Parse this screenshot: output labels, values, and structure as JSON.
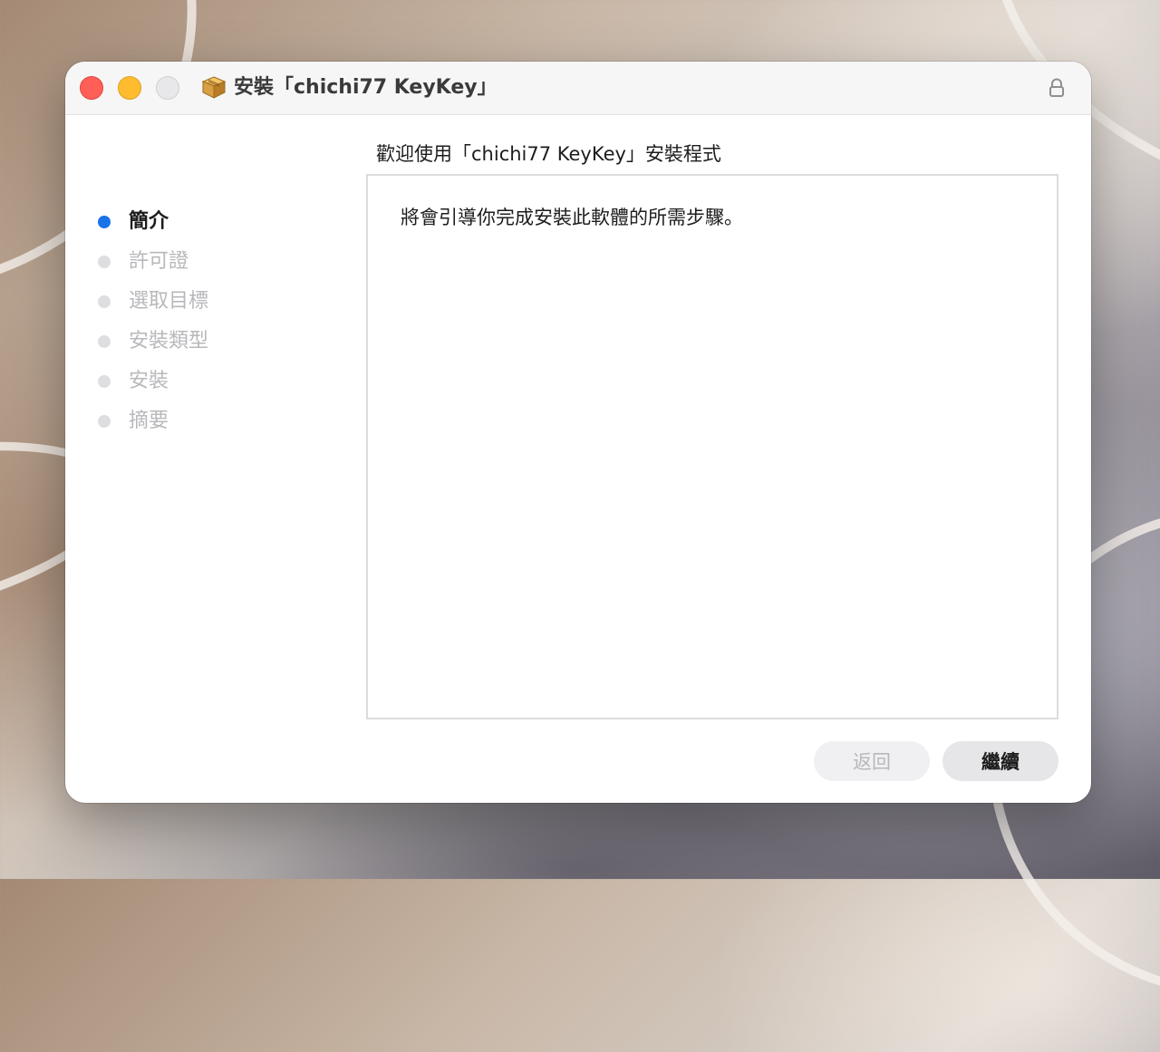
{
  "window": {
    "title": "安裝「chichi77 KeyKey」",
    "icon": "package-icon",
    "lock_icon": "lock-icon"
  },
  "main": {
    "heading": "歡迎使用「chichi77 KeyKey」安裝程式",
    "body": "將會引導你完成安裝此軟體的所需步驟。"
  },
  "sidebar": {
    "steps": [
      {
        "label": "簡介",
        "active": true
      },
      {
        "label": "許可證",
        "active": false
      },
      {
        "label": "選取目標",
        "active": false
      },
      {
        "label": "安裝類型",
        "active": false
      },
      {
        "label": "安裝",
        "active": false
      },
      {
        "label": "摘要",
        "active": false
      }
    ]
  },
  "buttons": {
    "back_label": "返回",
    "continue_label": "繼續"
  },
  "colors": {
    "active_step": "#1a73e8",
    "inactive_step": "#dedee0",
    "close": "#ff5f57",
    "minimize": "#febc2e"
  }
}
